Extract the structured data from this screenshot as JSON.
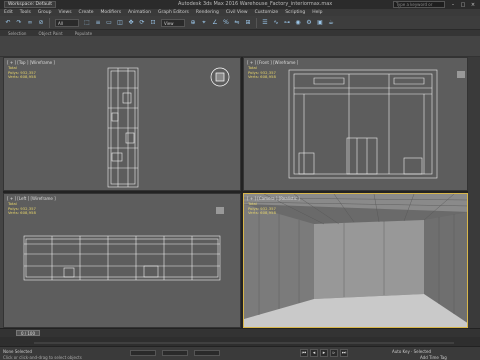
{
  "titlebar": {
    "workspace": "Workspace: Default",
    "title": "Autodesk 3ds Max 2016   Warehouse_Factory_interiormax.max",
    "search_placeholder": "Type a keyword or phrase"
  },
  "menu": [
    "Edit",
    "Tools",
    "Group",
    "Views",
    "Create",
    "Modifiers",
    "Animation",
    "Graph Editors",
    "Rendering",
    "Civil View",
    "Customize",
    "Scripting",
    "Help"
  ],
  "toolbar": {
    "selection_filter": "All",
    "ref_coord": "View"
  },
  "ribbon": [
    "Selection",
    "Object Paint",
    "Populate"
  ],
  "viewports": {
    "top": {
      "label": "[ + ] [Top ] [Wireframe ]",
      "total": "Total",
      "polys_label": "Polys:",
      "polys": "932,357",
      "verts_label": "Verts:",
      "verts": "608,958"
    },
    "front": {
      "label": "[ + ] [Front ] [Wireframe ]",
      "total": "Total",
      "polys_label": "Polys:",
      "polys": "932,357",
      "verts_label": "Verts:",
      "verts": "608,958"
    },
    "left": {
      "label": "[ + ] [Left ] [Wireframe ]",
      "total": "Total",
      "polys_label": "Polys:",
      "polys": "932,357",
      "verts_label": "Verts:",
      "verts": "608,958"
    },
    "persp": {
      "label": "[ + ] [Camera ] [Realistic ]",
      "total": "Total",
      "polys_label": "Polys:",
      "polys": "932,357",
      "verts_label": "Verts:",
      "verts": "608,958"
    }
  },
  "timeline": {
    "frame": "0 / 100"
  },
  "status": {
    "selection": "None Selected",
    "prompt": "Click or click-and-drag to select objects",
    "autokey": "Auto Key",
    "setkey": "Set Key",
    "selected_label": "Selected",
    "add_time_tag": "Add Time Tag"
  }
}
